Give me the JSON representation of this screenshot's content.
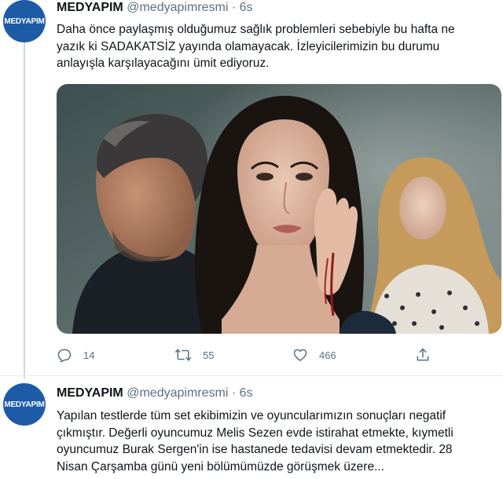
{
  "tweets": [
    {
      "avatar_text": "MEDYAPIM",
      "name": "MEDYAPIM",
      "handle": "@medyapimresmi",
      "separator": "·",
      "time": "6s",
      "text_lines": [
        "Daha önce paylaşmış olduğumuz sağlık problemleri sebebiyle bu hafta ne",
        "yazık ki SADAKATSİZ yayında olamayacak. İzleyicilerimizin bu durumu",
        "anlayışla karşılayacağını ümit ediyoruz."
      ],
      "image_alt": "Sadakatsiz promotional photo",
      "actions": {
        "reply_icon": "reply-icon",
        "reply_count": "14",
        "retweet_icon": "retweet-icon",
        "retweet_count": "55",
        "like_icon": "heart-icon",
        "like_count": "466",
        "share_icon": "share-icon"
      }
    },
    {
      "avatar_text": "MEDYAPIM",
      "name": "MEDYAPIM",
      "handle": "@medyapimresmi",
      "separator": "·",
      "time": "6s",
      "text_lines": [
        "Yapılan testlerde tüm set ekibimizin ve oyuncularımızın sonuçları negatif",
        "çıkmıştır. Değerli oyuncumuz Melis Sezen evde istirahat etmekte, kıymetli",
        "oyuncumuz Burak Sergen'in ise hastanede tedavisi devam etmektedir. 28",
        "Nisan Çarşamba günü yeni bölümümüzde görüşmek üzere..."
      ]
    }
  ],
  "colors": {
    "avatar_bg": "#1d5ba6",
    "meta_text": "#5b7083",
    "thread_line": "#cfd9de"
  }
}
